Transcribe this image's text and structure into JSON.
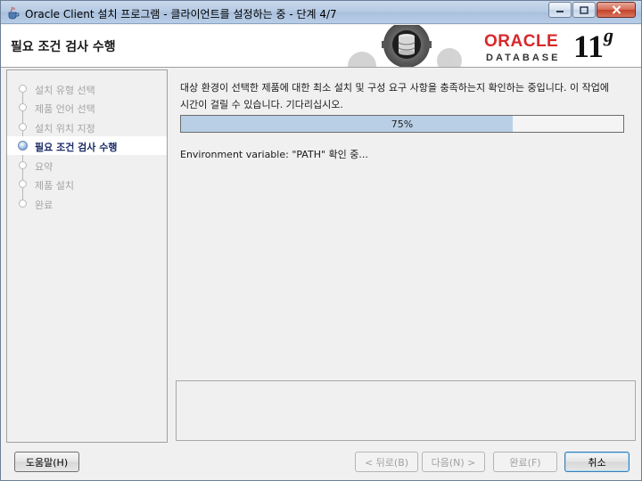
{
  "window": {
    "title": "Oracle Client 설치 프로그램 - 클라이언트를 설정하는 중 - 단계 4/7"
  },
  "header": {
    "page_title": "필요 조건 검사 수행",
    "logo_text": "ORACLE",
    "logo_sub": "DATABASE",
    "version": "11",
    "version_suffix": "g"
  },
  "steps": [
    {
      "label": "설치 유형 선택",
      "state": "done"
    },
    {
      "label": "제품 언어 선택",
      "state": "done"
    },
    {
      "label": "설치 위치 지정",
      "state": "done"
    },
    {
      "label": "필요 조건 검사 수행",
      "state": "active"
    },
    {
      "label": "요약",
      "state": "pending"
    },
    {
      "label": "제품 설치",
      "state": "pending"
    },
    {
      "label": "완료",
      "state": "pending"
    }
  ],
  "main": {
    "description": "대상 환경이 선택한 제품에 대한 최소 설치 및 구성 요구 사항을 충족하는지 확인하는 중입니다. 이 작업에 시간이 걸릴 수 있습니다. 기다리십시오.",
    "progress_percent": 75,
    "progress_label": "75%",
    "status_text": "Environment variable: \"PATH\" 확인 중..."
  },
  "buttons": {
    "help": "도움말(H)",
    "back": "< 뒤로(B)",
    "next": "다음(N) >",
    "finish": "완료(F)",
    "cancel": "취소"
  },
  "colors": {
    "oracle_red": "#d8282b",
    "progress_fill": "#b8cfe6",
    "active_step": "#1b2b66"
  }
}
